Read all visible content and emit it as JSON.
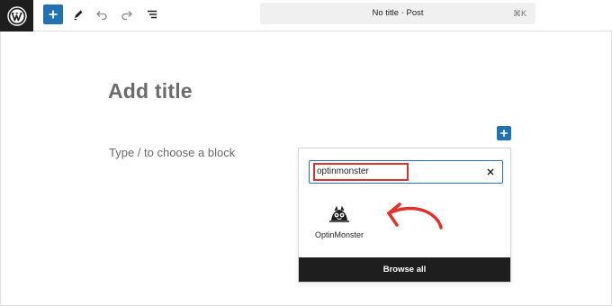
{
  "toolbar": {
    "logo_icon": "wordpress-logo-icon",
    "add_block_icon": "plus-icon",
    "edit_tool_icon": "pencil-icon",
    "undo_icon": "undo-icon",
    "redo_icon": "redo-icon",
    "list_view_icon": "list-view-icon",
    "accent_color": "#2271b1"
  },
  "document_bar": {
    "title": "No title · Post",
    "shortcut": "⌘K"
  },
  "canvas": {
    "title_placeholder": "Add title",
    "block_hint": "Type / to choose a block"
  },
  "inserter": {
    "search_value": "optinmonster",
    "clear_icon": "close-icon",
    "results": [
      {
        "label": "OptinMonster",
        "icon": "optinmonster-icon"
      }
    ],
    "browse_all_label": "Browse all",
    "highlight_color": "#e0312b"
  }
}
